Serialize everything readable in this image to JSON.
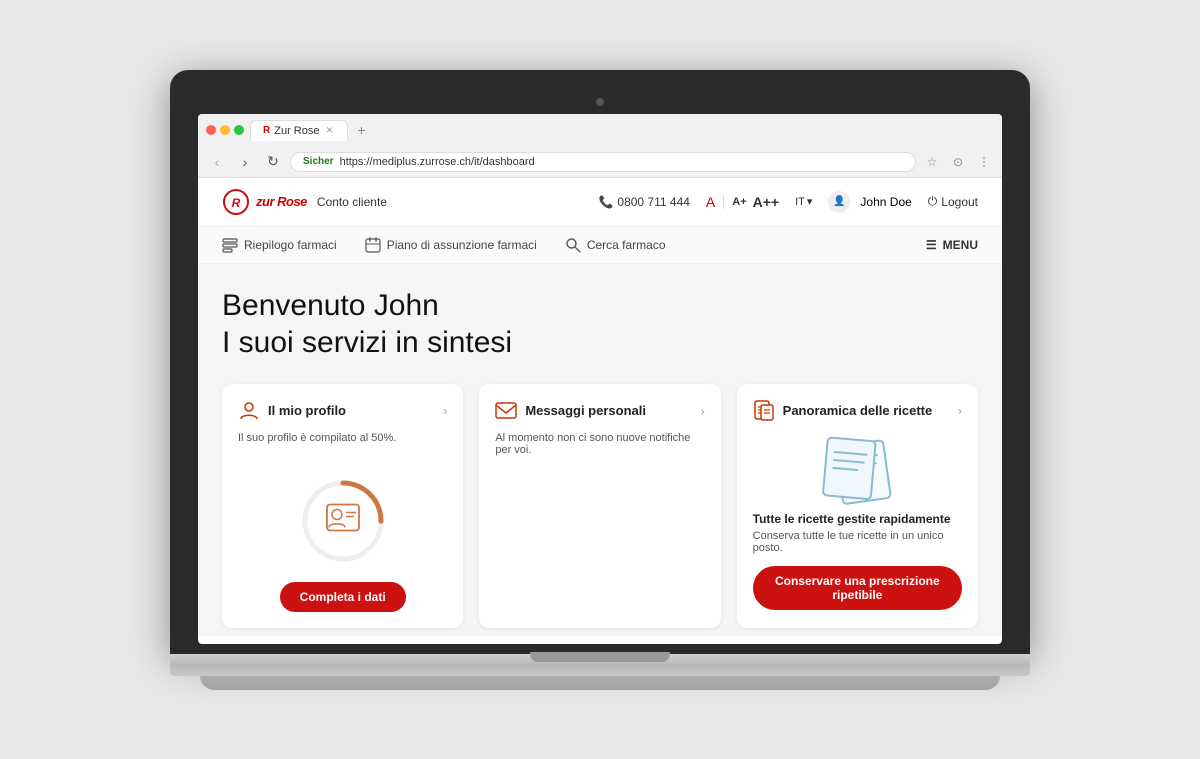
{
  "browser": {
    "tab_favicon": "R",
    "tab_title": "Zur Rose",
    "new_tab_label": "+",
    "back_btn": "‹",
    "forward_btn": "›",
    "refresh_btn": "↻",
    "secure_label": "Sicher",
    "url": "https://mediplus.zurrose.ch/it/dashboard",
    "ext_icon": "⋯",
    "star_icon": "☆",
    "profile_icon": "⊙",
    "menu_icon": "⋮"
  },
  "header": {
    "logo_text": "zur Rose",
    "logo_subtitle": "Conto cliente",
    "phone_icon": "☎",
    "phone": "0800 711 444",
    "font_warning": "A",
    "font_sm": "A+",
    "font_lg": "A++",
    "lang": "IT",
    "lang_arrow": "▾",
    "user_icon": "👤",
    "user_name": "John Doe",
    "logout_icon": "⏻",
    "logout_label": "Logout"
  },
  "nav": {
    "items": [
      {
        "icon": "⊟",
        "label": "Riepilogo farmaci"
      },
      {
        "icon": "📅",
        "label": "Piano di assunzione farmaci"
      },
      {
        "icon": "🔍",
        "label": "Cerca farmaco"
      }
    ],
    "menu_icon": "☰",
    "menu_label": "MENU"
  },
  "main": {
    "welcome_name": "Benvenuto John",
    "welcome_sub": "I suoi servizi in sintesi",
    "cards": [
      {
        "id": "profile",
        "icon": "👤",
        "title": "Il mio profilo",
        "arrow": "›",
        "description": "Il suo profilo è compilato al 50%.",
        "progress": 50,
        "btn_label": "Completa i dati"
      },
      {
        "id": "messages",
        "icon": "✉",
        "title": "Messaggi personali",
        "arrow": "›",
        "description": "Al momento non ci sono nuove notifiche per voi."
      },
      {
        "id": "prescriptions",
        "icon": "📋",
        "title": "Panoramica delle ricette",
        "arrow": "›",
        "section_title": "Tutte le ricette gestite rapidamente",
        "section_desc": "Conserva tutte le tue ricette in un unico posto.",
        "btn_label": "Conservare una prescrizione ripetibile"
      }
    ]
  },
  "colors": {
    "brand_red": "#cc1111",
    "accent_orange": "#cc7744",
    "accent_blue": "#8bbccc"
  }
}
